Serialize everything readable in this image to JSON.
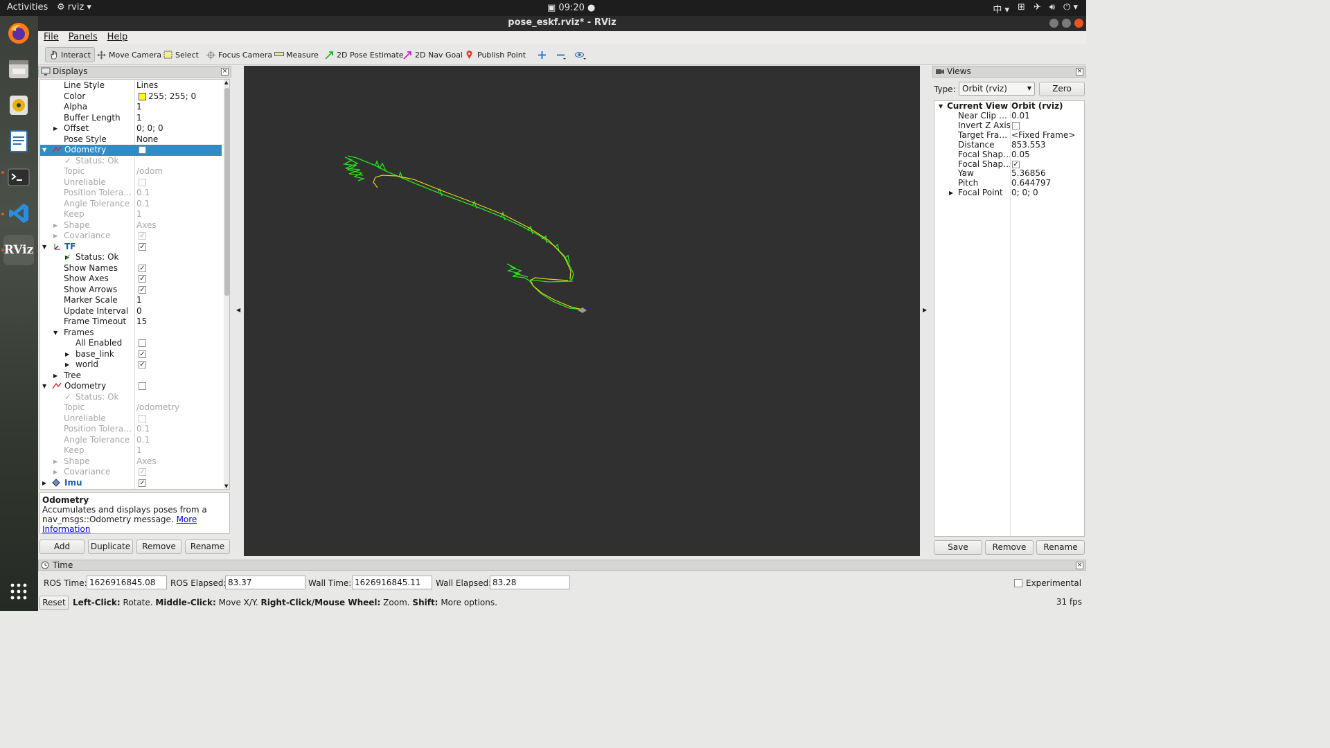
{
  "topbar": {
    "activities": "Activities",
    "app": "rviz",
    "clock": "09:20"
  },
  "window": {
    "title": "pose_eskf.rviz* - RViz"
  },
  "menu": [
    "File",
    "Panels",
    "Help"
  ],
  "toolbar": {
    "interact": "Interact",
    "move_camera": "Move Camera",
    "select": "Select",
    "focus_camera": "Focus Camera",
    "measure": "Measure",
    "pose_estimate": "2D Pose Estimate",
    "nav_goal": "2D Nav Goal",
    "publish_point": "Publish Point"
  },
  "displays": {
    "title": "Displays",
    "rows": [
      {
        "name": "Line Style",
        "value": "Lines",
        "indent": 1
      },
      {
        "name": "Color",
        "value": "255; 255; 0",
        "indent": 1,
        "swatch": "#ffff00"
      },
      {
        "name": "Alpha",
        "value": "1",
        "indent": 1
      },
      {
        "name": "Buffer Length",
        "value": "1",
        "indent": 1
      },
      {
        "name": "Offset",
        "value": "0; 0; 0",
        "indent": 1,
        "arrow": "right"
      },
      {
        "name": "Pose Style",
        "value": "None",
        "indent": 1
      },
      {
        "name": "Odometry",
        "value": "",
        "indent": 0,
        "arrow": "down",
        "selected": true,
        "checkbox": false,
        "icon": "odom"
      },
      {
        "name": "Status: Ok",
        "value": "",
        "indent": 2,
        "disabled": true,
        "status": true
      },
      {
        "name": "Topic",
        "value": "/odom",
        "indent": 1,
        "disabled": true
      },
      {
        "name": "Unreliable",
        "value": "",
        "indent": 1,
        "disabled": true,
        "checkbox": false
      },
      {
        "name": "Position Tolera…",
        "value": "0.1",
        "indent": 1,
        "disabled": true
      },
      {
        "name": "Angle Tolerance",
        "value": "0.1",
        "indent": 1,
        "disabled": true
      },
      {
        "name": "Keep",
        "value": "1",
        "indent": 1,
        "disabled": true
      },
      {
        "name": "Shape",
        "value": "Axes",
        "indent": 1,
        "disabled": true,
        "arrow": "right"
      },
      {
        "name": "Covariance",
        "value": "",
        "indent": 1,
        "disabled": true,
        "arrow": "right",
        "checkbox": true
      },
      {
        "name": "TF",
        "value": "",
        "indent": 0,
        "arrow": "down",
        "checkbox": true,
        "icon": "tf",
        "blue": true
      },
      {
        "name": "Status: Ok",
        "value": "",
        "indent": 2,
        "status": true,
        "arrow": "right"
      },
      {
        "name": "Show Names",
        "value": "",
        "indent": 1,
        "checkbox": true
      },
      {
        "name": "Show Axes",
        "value": "",
        "indent": 1,
        "checkbox": true
      },
      {
        "name": "Show Arrows",
        "value": "",
        "indent": 1,
        "checkbox": true
      },
      {
        "name": "Marker Scale",
        "value": "1",
        "indent": 1
      },
      {
        "name": "Update Interval",
        "value": "0",
        "indent": 1
      },
      {
        "name": "Frame Timeout",
        "value": "15",
        "indent": 1
      },
      {
        "name": "Frames",
        "value": "",
        "indent": 1,
        "arrow": "down"
      },
      {
        "name": "All Enabled",
        "value": "",
        "indent": 2,
        "checkbox": false
      },
      {
        "name": "base_link",
        "value": "",
        "indent": 2,
        "arrow": "right",
        "checkbox": true
      },
      {
        "name": "world",
        "value": "",
        "indent": 2,
        "arrow": "right",
        "checkbox": true
      },
      {
        "name": "Tree",
        "value": "",
        "indent": 1,
        "arrow": "right"
      },
      {
        "name": "Odometry",
        "value": "",
        "indent": 0,
        "arrow": "down",
        "checkbox": false,
        "icon": "odom"
      },
      {
        "name": "Status: Ok",
        "value": "",
        "indent": 2,
        "disabled": true,
        "status": true
      },
      {
        "name": "Topic",
        "value": "/odometry",
        "indent": 1,
        "disabled": true
      },
      {
        "name": "Unreliable",
        "value": "",
        "indent": 1,
        "disabled": true,
        "checkbox": false
      },
      {
        "name": "Position Tolera…",
        "value": "0.1",
        "indent": 1,
        "disabled": true
      },
      {
        "name": "Angle Tolerance",
        "value": "0.1",
        "indent": 1,
        "disabled": true
      },
      {
        "name": "Keep",
        "value": "1",
        "indent": 1,
        "disabled": true
      },
      {
        "name": "Shape",
        "value": "Axes",
        "indent": 1,
        "disabled": true,
        "arrow": "right"
      },
      {
        "name": "Covariance",
        "value": "",
        "indent": 1,
        "disabled": true,
        "arrow": "right",
        "checkbox": true
      },
      {
        "name": "Imu",
        "value": "",
        "indent": 0,
        "arrow": "right",
        "checkbox": true,
        "icon": "imu",
        "blue": true
      }
    ],
    "description": {
      "title": "Odometry",
      "text": "Accumulates and displays poses from a nav_msgs::Odometry message.",
      "link1": "More",
      "link2": "Information"
    },
    "buttons": {
      "add": "Add",
      "duplicate": "Duplicate",
      "remove": "Remove",
      "rename": "Rename"
    }
  },
  "views": {
    "title": "Views",
    "type_label": "Type:",
    "type_value": "Orbit (rviz)",
    "zero": "Zero",
    "current_view": "Current View",
    "current_view_type": "Orbit (rviz)",
    "rows": [
      {
        "name": "Near Clip …",
        "value": "0.01"
      },
      {
        "name": "Invert Z Axis",
        "value": "",
        "checkbox": false
      },
      {
        "name": "Target Fra…",
        "value": "<Fixed Frame>"
      },
      {
        "name": "Distance",
        "value": "853.553"
      },
      {
        "name": "Focal Shap…",
        "value": "0.05"
      },
      {
        "name": "Focal Shap…",
        "value": "",
        "checkbox": true
      },
      {
        "name": "Yaw",
        "value": "5.36856"
      },
      {
        "name": "Pitch",
        "value": "0.644797"
      },
      {
        "name": "Focal Point",
        "value": "0; 0; 0",
        "arrow": true
      }
    ],
    "buttons": {
      "save": "Save",
      "remove": "Remove",
      "rename": "Rename"
    }
  },
  "time": {
    "title": "Time",
    "ros_time_label": "ROS Time:",
    "ros_time": "1626916845.08",
    "ros_elapsed_label": "ROS Elapsed:",
    "ros_elapsed": "83.37",
    "wall_time_label": "Wall Time:",
    "wall_time": "1626916845.11",
    "wall_elapsed_label": "Wall Elapsed:",
    "wall_elapsed": "83.28",
    "experimental": "Experimental"
  },
  "status": {
    "reset": "Reset",
    "left_click": "Left-Click:",
    "left_text": "Rotate.",
    "middle_click": "Middle-Click:",
    "middle_text": "Move X/Y.",
    "right_click": "Right-Click/Mouse Wheel:",
    "right_text": "Zoom.",
    "shift": "Shift:",
    "shift_text": "More options.",
    "fps": "31 fps"
  },
  "colors": {
    "accent": "#e95420",
    "selection": "#308cc6",
    "trajectory_green": "#22e01c",
    "trajectory_yellow": "#e8d21a",
    "viewport": "#303030"
  }
}
